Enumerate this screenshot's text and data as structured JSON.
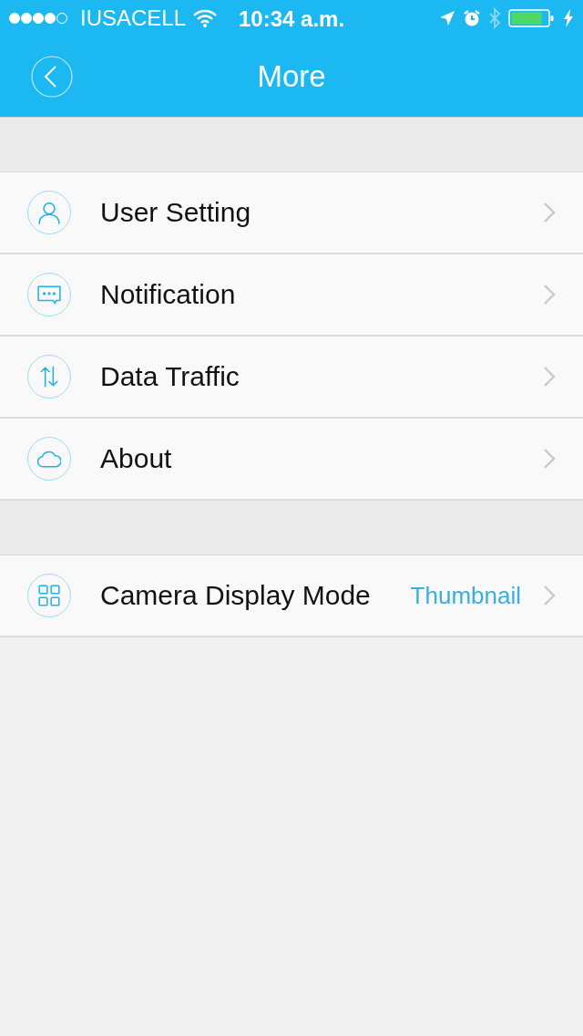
{
  "status_bar": {
    "carrier": "IUSACELL",
    "time": "10:34 a.m."
  },
  "nav": {
    "title": "More"
  },
  "groups": [
    {
      "items": [
        {
          "label": "User Setting"
        },
        {
          "label": "Notification"
        },
        {
          "label": "Data Traffic"
        },
        {
          "label": "About"
        }
      ]
    },
    {
      "items": [
        {
          "label": "Camera Display Mode",
          "value": "Thumbnail"
        }
      ]
    }
  ]
}
